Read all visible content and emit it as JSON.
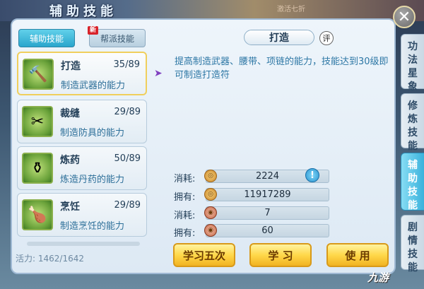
{
  "header": {
    "title": "辅助技能",
    "watermark": "激活七折"
  },
  "tabs": [
    {
      "label": "辅助技能",
      "active": true
    },
    {
      "label": "帮派技能",
      "active": false,
      "badge": "新"
    }
  ],
  "skills": [
    {
      "name": "打造",
      "level": "35/89",
      "desc": "制造武器的能力",
      "icon": "hammer-icon",
      "selected": true
    },
    {
      "name": "裁缝",
      "level": "29/89",
      "desc": "制造防具的能力",
      "icon": "scissors-icon",
      "selected": false
    },
    {
      "name": "炼药",
      "level": "50/89",
      "desc": "炼造丹药的能力",
      "icon": "cauldron-icon",
      "selected": false
    },
    {
      "name": "烹饪",
      "level": "29/89",
      "desc": "制造烹饪的能力",
      "icon": "drumstick-icon",
      "selected": false
    }
  ],
  "vitality": "活力: 1462/1642",
  "detail": {
    "title": "打造",
    "review": "评",
    "description": "提高制造武器、腰带、项链的能力，技能达到30级即可制造打造符"
  },
  "resources": [
    {
      "label": "消耗:",
      "value": "2224",
      "icon": "coin-icon"
    },
    {
      "label": "拥有:",
      "value": "11917289",
      "icon": "coin-icon"
    },
    {
      "label": "消耗:",
      "value": "7",
      "icon": "seal-icon"
    },
    {
      "label": "拥有:",
      "value": "60",
      "icon": "seal-icon"
    }
  ],
  "actions": {
    "learn5": "学习五次",
    "learn": "学 习",
    "use": "使 用"
  },
  "side_tabs": [
    {
      "label": "功法星象",
      "active": false
    },
    {
      "label": "修炼技能",
      "active": false
    },
    {
      "label": "辅助技能",
      "active": true
    },
    {
      "label": "剧情技能",
      "active": false
    }
  ],
  "logo": "九游",
  "colors": {
    "accent": "#2aa6cc",
    "button_gold": "#ffd84a",
    "desc_blue": "#2d77a5"
  }
}
